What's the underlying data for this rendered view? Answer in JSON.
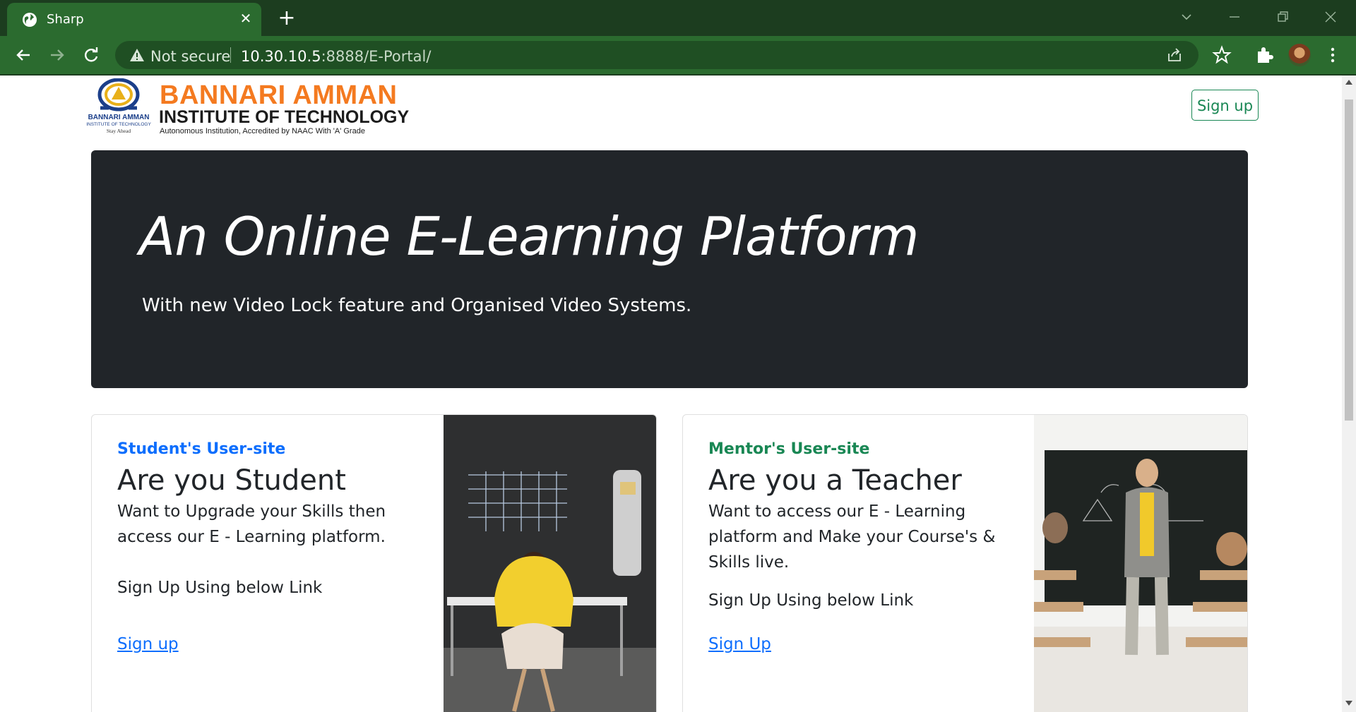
{
  "browser": {
    "tab_title": "Sharp",
    "new_tab_symbol": "+",
    "close_symbol": "✕",
    "address_security": "Not secure",
    "address_host": "10.30.10.5",
    "address_path": ":8888/E-Portal/",
    "icons": [
      "globe-icon",
      "close-icon",
      "new-tab-icon",
      "back-icon",
      "forward-icon",
      "reload-icon",
      "warning-icon",
      "share-icon",
      "star-icon",
      "extensions-icon",
      "profile-avatar",
      "menu-icon"
    ]
  },
  "header": {
    "logo_line1": "BANNARI AMMAN",
    "logo_line2": "INSTITUTE OF TECHNOLOGY",
    "logo_line3": "Autonomous Institution, Accredited by NAAC With 'A' Grade",
    "emblem_line1": "BANNARI AMMAN",
    "emblem_line2": "INSTITUTE OF TECHNOLOGY",
    "emblem_line3": "Stay Ahead",
    "signup_label": "Sign up"
  },
  "hero": {
    "title": "An Online E-Learning Platform",
    "subtitle": "With new Video Lock feature and Organised Video Systems."
  },
  "cards": {
    "student": {
      "eyebrow": "Student's User-site",
      "title": "Are you Student",
      "text": "Want to Upgrade your Skills then access our E - Learning platform.",
      "signup_text": "Sign Up Using below Link",
      "link": "Sign up",
      "accent": "#0d6efd"
    },
    "mentor": {
      "eyebrow": "Mentor's User-site",
      "title": "Are you a Teacher",
      "text": "Want to access our E - Learning platform and Make your Course's & Skills live.",
      "signup_text": "Sign Up Using below Link",
      "link": "Sign Up",
      "accent": "#198754"
    }
  },
  "colors": {
    "browser_frame": "#1c3d1f",
    "browser_toolbar": "#2b6b2f",
    "hero_bg": "#212529",
    "primary": "#0d6efd",
    "success": "#198754"
  }
}
